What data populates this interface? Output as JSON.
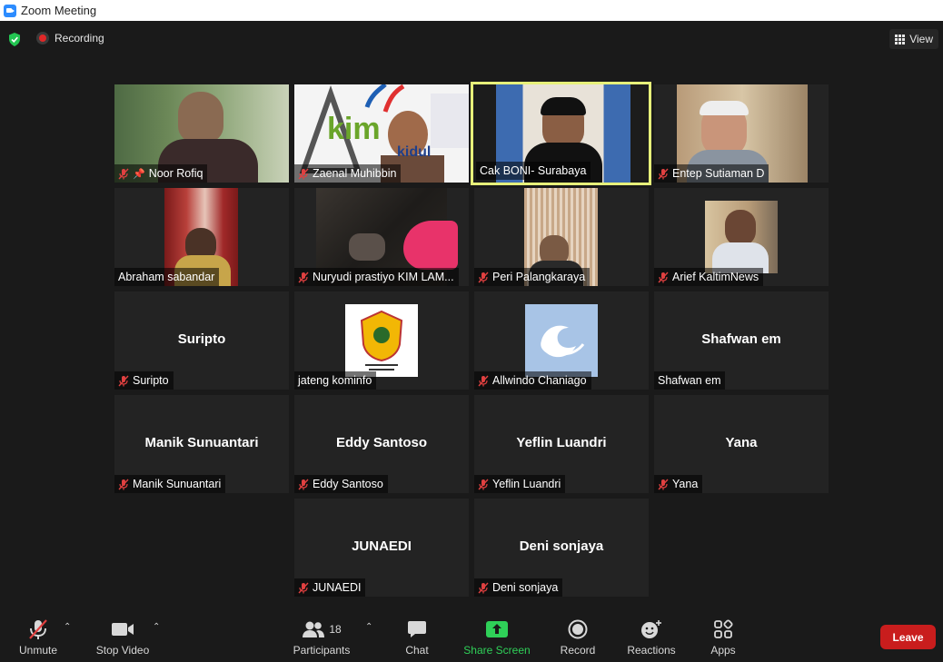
{
  "window": {
    "title": "Zoom Meeting"
  },
  "topbar": {
    "recording_label": "Recording",
    "view_label": "View"
  },
  "participants_grid": [
    {
      "name": "Noor Rofiq",
      "muted": true,
      "pinned": true,
      "video": true
    },
    {
      "name": "Zaenal Muhibbin",
      "muted": true,
      "video": true,
      "overlay_text": "kim",
      "overlay_text2": "kidul"
    },
    {
      "name": "Cak BONI- Surabaya",
      "muted": false,
      "video": true,
      "active": true
    },
    {
      "name": "Entep Sutiaman D",
      "muted": true,
      "video": true
    },
    {
      "name": "Abraham sabandar",
      "muted": false,
      "video": true
    },
    {
      "name": "Nuryudi prastiyo KIM LAM...",
      "muted": true,
      "video": true
    },
    {
      "name": "Peri Palangkaraya",
      "muted": true,
      "video": true
    },
    {
      "name": "Arief KaltimNews",
      "muted": true,
      "video": true
    },
    {
      "name": "Suripto",
      "muted": true,
      "video": false,
      "center_name": "Suripto"
    },
    {
      "name": "jateng kominfo",
      "muted": false,
      "video": false,
      "avatar": "logo"
    },
    {
      "name": "Allwindo Chaniago",
      "muted": true,
      "video": false,
      "avatar": "wave"
    },
    {
      "name": "Shafwan em",
      "muted": false,
      "video": false,
      "center_name": "Shafwan em"
    },
    {
      "name": "Manik Sunuantari",
      "muted": true,
      "video": false,
      "center_name": "Manik Sunuantari"
    },
    {
      "name": "Eddy Santoso",
      "muted": true,
      "video": false,
      "center_name": "Eddy Santoso"
    },
    {
      "name": "Yeflin Luandri",
      "muted": true,
      "video": false,
      "center_name": "Yeflin Luandri"
    },
    {
      "name": "Yana",
      "muted": true,
      "video": false,
      "center_name": "Yana"
    },
    {
      "name": "JUNAEDI",
      "muted": true,
      "video": false,
      "center_name": "JUNAEDI"
    },
    {
      "name": "Deni sonjaya",
      "muted": true,
      "video": false,
      "center_name": "Deni sonjaya"
    }
  ],
  "toolbar": {
    "unmute": "Unmute",
    "stop_video": "Stop Video",
    "participants": "Participants",
    "participants_count": "18",
    "chat": "Chat",
    "share_screen": "Share Screen",
    "record": "Record",
    "reactions": "Reactions",
    "apps": "Apps",
    "leave": "Leave"
  },
  "colors": {
    "background": "#1a1a1a",
    "tile": "#232323",
    "active_speaker_border": "#e7f07a",
    "share_green": "#2fd058",
    "leave_red": "#c91d1d",
    "mute_red": "#e04040"
  }
}
